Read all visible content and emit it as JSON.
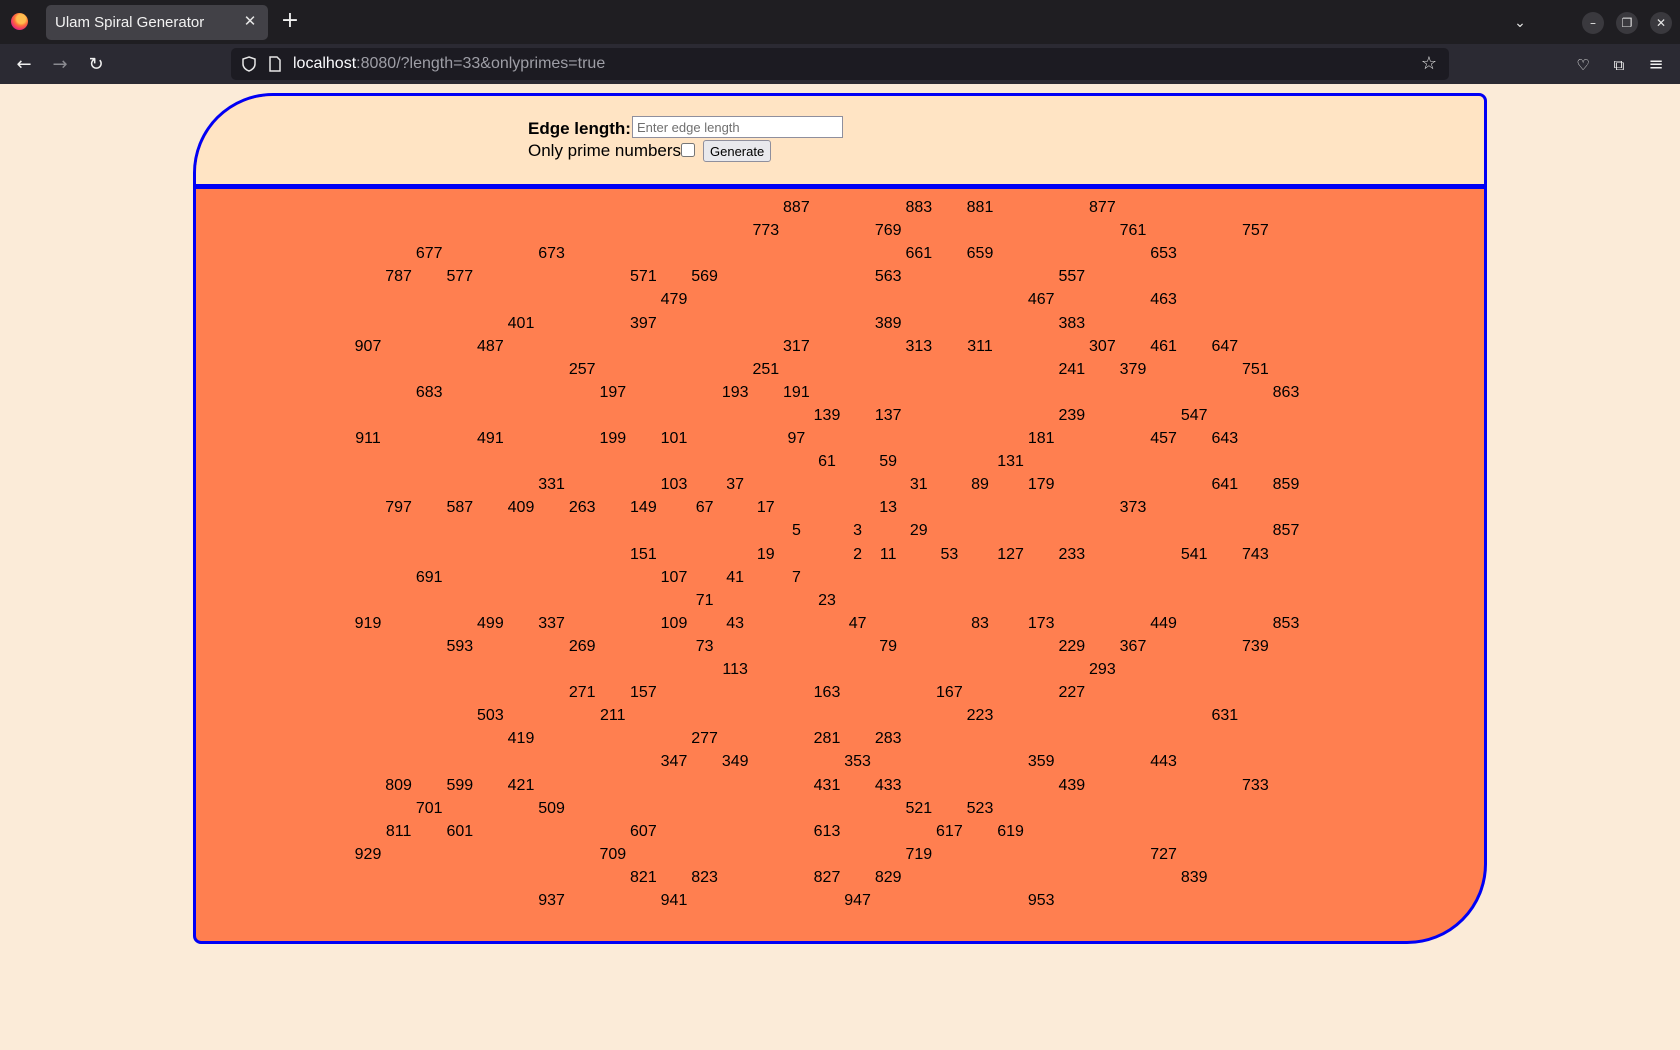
{
  "browser": {
    "tab_title": "Ulam Spiral Generator",
    "url_host": "localhost",
    "url_rest": ":8080/?length=33&onlyprimes=true"
  },
  "form": {
    "edge_label": "Edge length:",
    "edge_placeholder": "Enter edge length",
    "primes_label": "Only prime numbers",
    "primes_checked": false,
    "generate_label": "Generate"
  },
  "spiral": {
    "edge_length": 33,
    "grid_columns": 33,
    "grid_rows": 31,
    "colors": {
      "background": "#ff7f50",
      "header": "#ffe4c4",
      "border": "#0000f5",
      "page": "#fbebd8"
    },
    "rows": [
      [
        [
          14,
          "887"
        ],
        [
          18,
          "883"
        ],
        [
          20,
          "881"
        ],
        [
          24,
          "877"
        ]
      ],
      [
        [
          13,
          "773"
        ],
        [
          17,
          "769"
        ],
        [
          25,
          "761"
        ],
        [
          29,
          "757"
        ]
      ],
      [
        [
          2,
          "677"
        ],
        [
          6,
          "673"
        ],
        [
          18,
          "661"
        ],
        [
          20,
          "659"
        ],
        [
          26,
          "653"
        ]
      ],
      [
        [
          1,
          "787"
        ],
        [
          3,
          "577"
        ],
        [
          9,
          "571"
        ],
        [
          11,
          "569"
        ],
        [
          17,
          "563"
        ],
        [
          23,
          "557"
        ]
      ],
      [
        [
          10,
          "479"
        ],
        [
          22,
          "467"
        ],
        [
          26,
          "463"
        ]
      ],
      [
        [
          5,
          "401"
        ],
        [
          9,
          "397"
        ],
        [
          17,
          "389"
        ],
        [
          23,
          "383"
        ]
      ],
      [
        [
          0,
          "907"
        ],
        [
          4,
          "487"
        ],
        [
          14,
          "317"
        ],
        [
          18,
          "313"
        ],
        [
          20,
          "311"
        ],
        [
          24,
          "307"
        ],
        [
          26,
          "461"
        ],
        [
          28,
          "647"
        ]
      ],
      [
        [
          7,
          "257"
        ],
        [
          13,
          "251"
        ],
        [
          23,
          "241"
        ],
        [
          25,
          "379"
        ],
        [
          29,
          "751"
        ]
      ],
      [
        [
          2,
          "683"
        ],
        [
          8,
          "197"
        ],
        [
          12,
          "193"
        ],
        [
          14,
          "191"
        ],
        [
          30,
          "863"
        ]
      ],
      [
        [
          15,
          "139"
        ],
        [
          17,
          "137"
        ],
        [
          23,
          "239"
        ],
        [
          27,
          "547"
        ]
      ],
      [
        [
          0,
          "911"
        ],
        [
          4,
          "491"
        ],
        [
          8,
          "199"
        ],
        [
          10,
          "101"
        ],
        [
          14,
          "97"
        ],
        [
          22,
          "181"
        ],
        [
          26,
          "457"
        ],
        [
          28,
          "643"
        ]
      ],
      [
        [
          15,
          "61"
        ],
        [
          17,
          "59"
        ],
        [
          21,
          "131"
        ]
      ],
      [
        [
          6,
          "331"
        ],
        [
          10,
          "103"
        ],
        [
          12,
          "37"
        ],
        [
          18,
          "31"
        ],
        [
          20,
          "89"
        ],
        [
          22,
          "179"
        ],
        [
          28,
          "641"
        ],
        [
          30,
          "859"
        ]
      ],
      [
        [
          1,
          "797"
        ],
        [
          3,
          "587"
        ],
        [
          5,
          "409"
        ],
        [
          7,
          "263"
        ],
        [
          9,
          "149"
        ],
        [
          11,
          "67"
        ],
        [
          13,
          "17"
        ],
        [
          17,
          "13"
        ],
        [
          25,
          "373"
        ]
      ],
      [
        [
          14,
          "5"
        ],
        [
          16,
          "3"
        ],
        [
          18,
          "29"
        ],
        [
          30,
          "857"
        ]
      ],
      [
        [
          9,
          "151"
        ],
        [
          13,
          "19"
        ],
        [
          16,
          "2"
        ],
        [
          17,
          "11"
        ],
        [
          19,
          "53"
        ],
        [
          21,
          "127"
        ],
        [
          23,
          "233"
        ],
        [
          27,
          "541"
        ],
        [
          29,
          "743"
        ]
      ],
      [
        [
          2,
          "691"
        ],
        [
          10,
          "107"
        ],
        [
          12,
          "41"
        ],
        [
          14,
          "7"
        ]
      ],
      [
        [
          11,
          "71"
        ],
        [
          15,
          "23"
        ]
      ],
      [
        [
          0,
          "919"
        ],
        [
          4,
          "499"
        ],
        [
          6,
          "337"
        ],
        [
          10,
          "109"
        ],
        [
          12,
          "43"
        ],
        [
          16,
          "47"
        ],
        [
          20,
          "83"
        ],
        [
          22,
          "173"
        ],
        [
          26,
          "449"
        ],
        [
          30,
          "853"
        ]
      ],
      [
        [
          3,
          "593"
        ],
        [
          7,
          "269"
        ],
        [
          11,
          "73"
        ],
        [
          17,
          "79"
        ],
        [
          23,
          "229"
        ],
        [
          25,
          "367"
        ],
        [
          29,
          "739"
        ]
      ],
      [
        [
          12,
          "113"
        ],
        [
          24,
          "293"
        ]
      ],
      [
        [
          7,
          "271"
        ],
        [
          9,
          "157"
        ],
        [
          15,
          "163"
        ],
        [
          19,
          "167"
        ],
        [
          23,
          "227"
        ]
      ],
      [
        [
          4,
          "503"
        ],
        [
          8,
          "211"
        ],
        [
          20,
          "223"
        ],
        [
          28,
          "631"
        ]
      ],
      [
        [
          5,
          "419"
        ],
        [
          11,
          "277"
        ],
        [
          15,
          "281"
        ],
        [
          17,
          "283"
        ]
      ],
      [
        [
          10,
          "347"
        ],
        [
          12,
          "349"
        ],
        [
          16,
          "353"
        ],
        [
          22,
          "359"
        ],
        [
          26,
          "443"
        ]
      ],
      [
        [
          1,
          "809"
        ],
        [
          3,
          "599"
        ],
        [
          5,
          "421"
        ],
        [
          15,
          "431"
        ],
        [
          17,
          "433"
        ],
        [
          23,
          "439"
        ],
        [
          29,
          "733"
        ]
      ],
      [
        [
          2,
          "701"
        ],
        [
          6,
          "509"
        ],
        [
          18,
          "521"
        ],
        [
          20,
          "523"
        ]
      ],
      [
        [
          1,
          "811"
        ],
        [
          3,
          "601"
        ],
        [
          9,
          "607"
        ],
        [
          15,
          "613"
        ],
        [
          19,
          "617"
        ],
        [
          21,
          "619"
        ]
      ],
      [
        [
          0,
          "929"
        ],
        [
          8,
          "709"
        ],
        [
          18,
          "719"
        ],
        [
          26,
          "727"
        ]
      ],
      [
        [
          9,
          "821"
        ],
        [
          11,
          "823"
        ],
        [
          15,
          "827"
        ],
        [
          17,
          "829"
        ],
        [
          27,
          "839"
        ]
      ],
      [
        [
          6,
          "937"
        ],
        [
          10,
          "941"
        ],
        [
          16,
          "947"
        ],
        [
          22,
          "953"
        ]
      ]
    ]
  }
}
